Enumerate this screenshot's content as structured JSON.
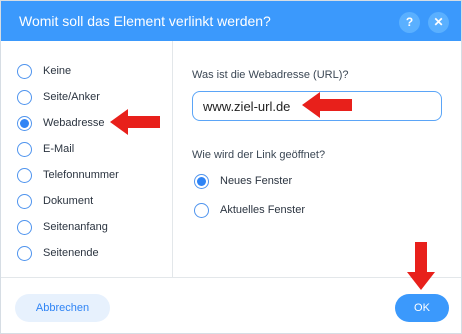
{
  "dialog": {
    "title": "Womit soll das Element verlinkt werden?",
    "help_label": "?",
    "close_label": "✕"
  },
  "link_types": [
    {
      "label": "Keine",
      "selected": false
    },
    {
      "label": "Seite/Anker",
      "selected": false
    },
    {
      "label": "Webadresse",
      "selected": true
    },
    {
      "label": "E-Mail",
      "selected": false
    },
    {
      "label": "Telefonnummer",
      "selected": false
    },
    {
      "label": "Dokument",
      "selected": false
    },
    {
      "label": "Seitenanfang",
      "selected": false
    },
    {
      "label": "Seitenende",
      "selected": false
    }
  ],
  "url_section": {
    "label": "Was ist die Webadresse (URL)?",
    "value": "www.ziel-url.de"
  },
  "open_section": {
    "label": "Wie wird der Link geöffnet?",
    "options": [
      {
        "label": "Neues Fenster",
        "selected": true
      },
      {
        "label": "Aktuelles Fenster",
        "selected": false
      }
    ]
  },
  "footer": {
    "cancel_label": "Abbrechen",
    "ok_label": "OK"
  },
  "colors": {
    "accent": "#3b99fc",
    "annotation_arrow": "#e8201b"
  }
}
